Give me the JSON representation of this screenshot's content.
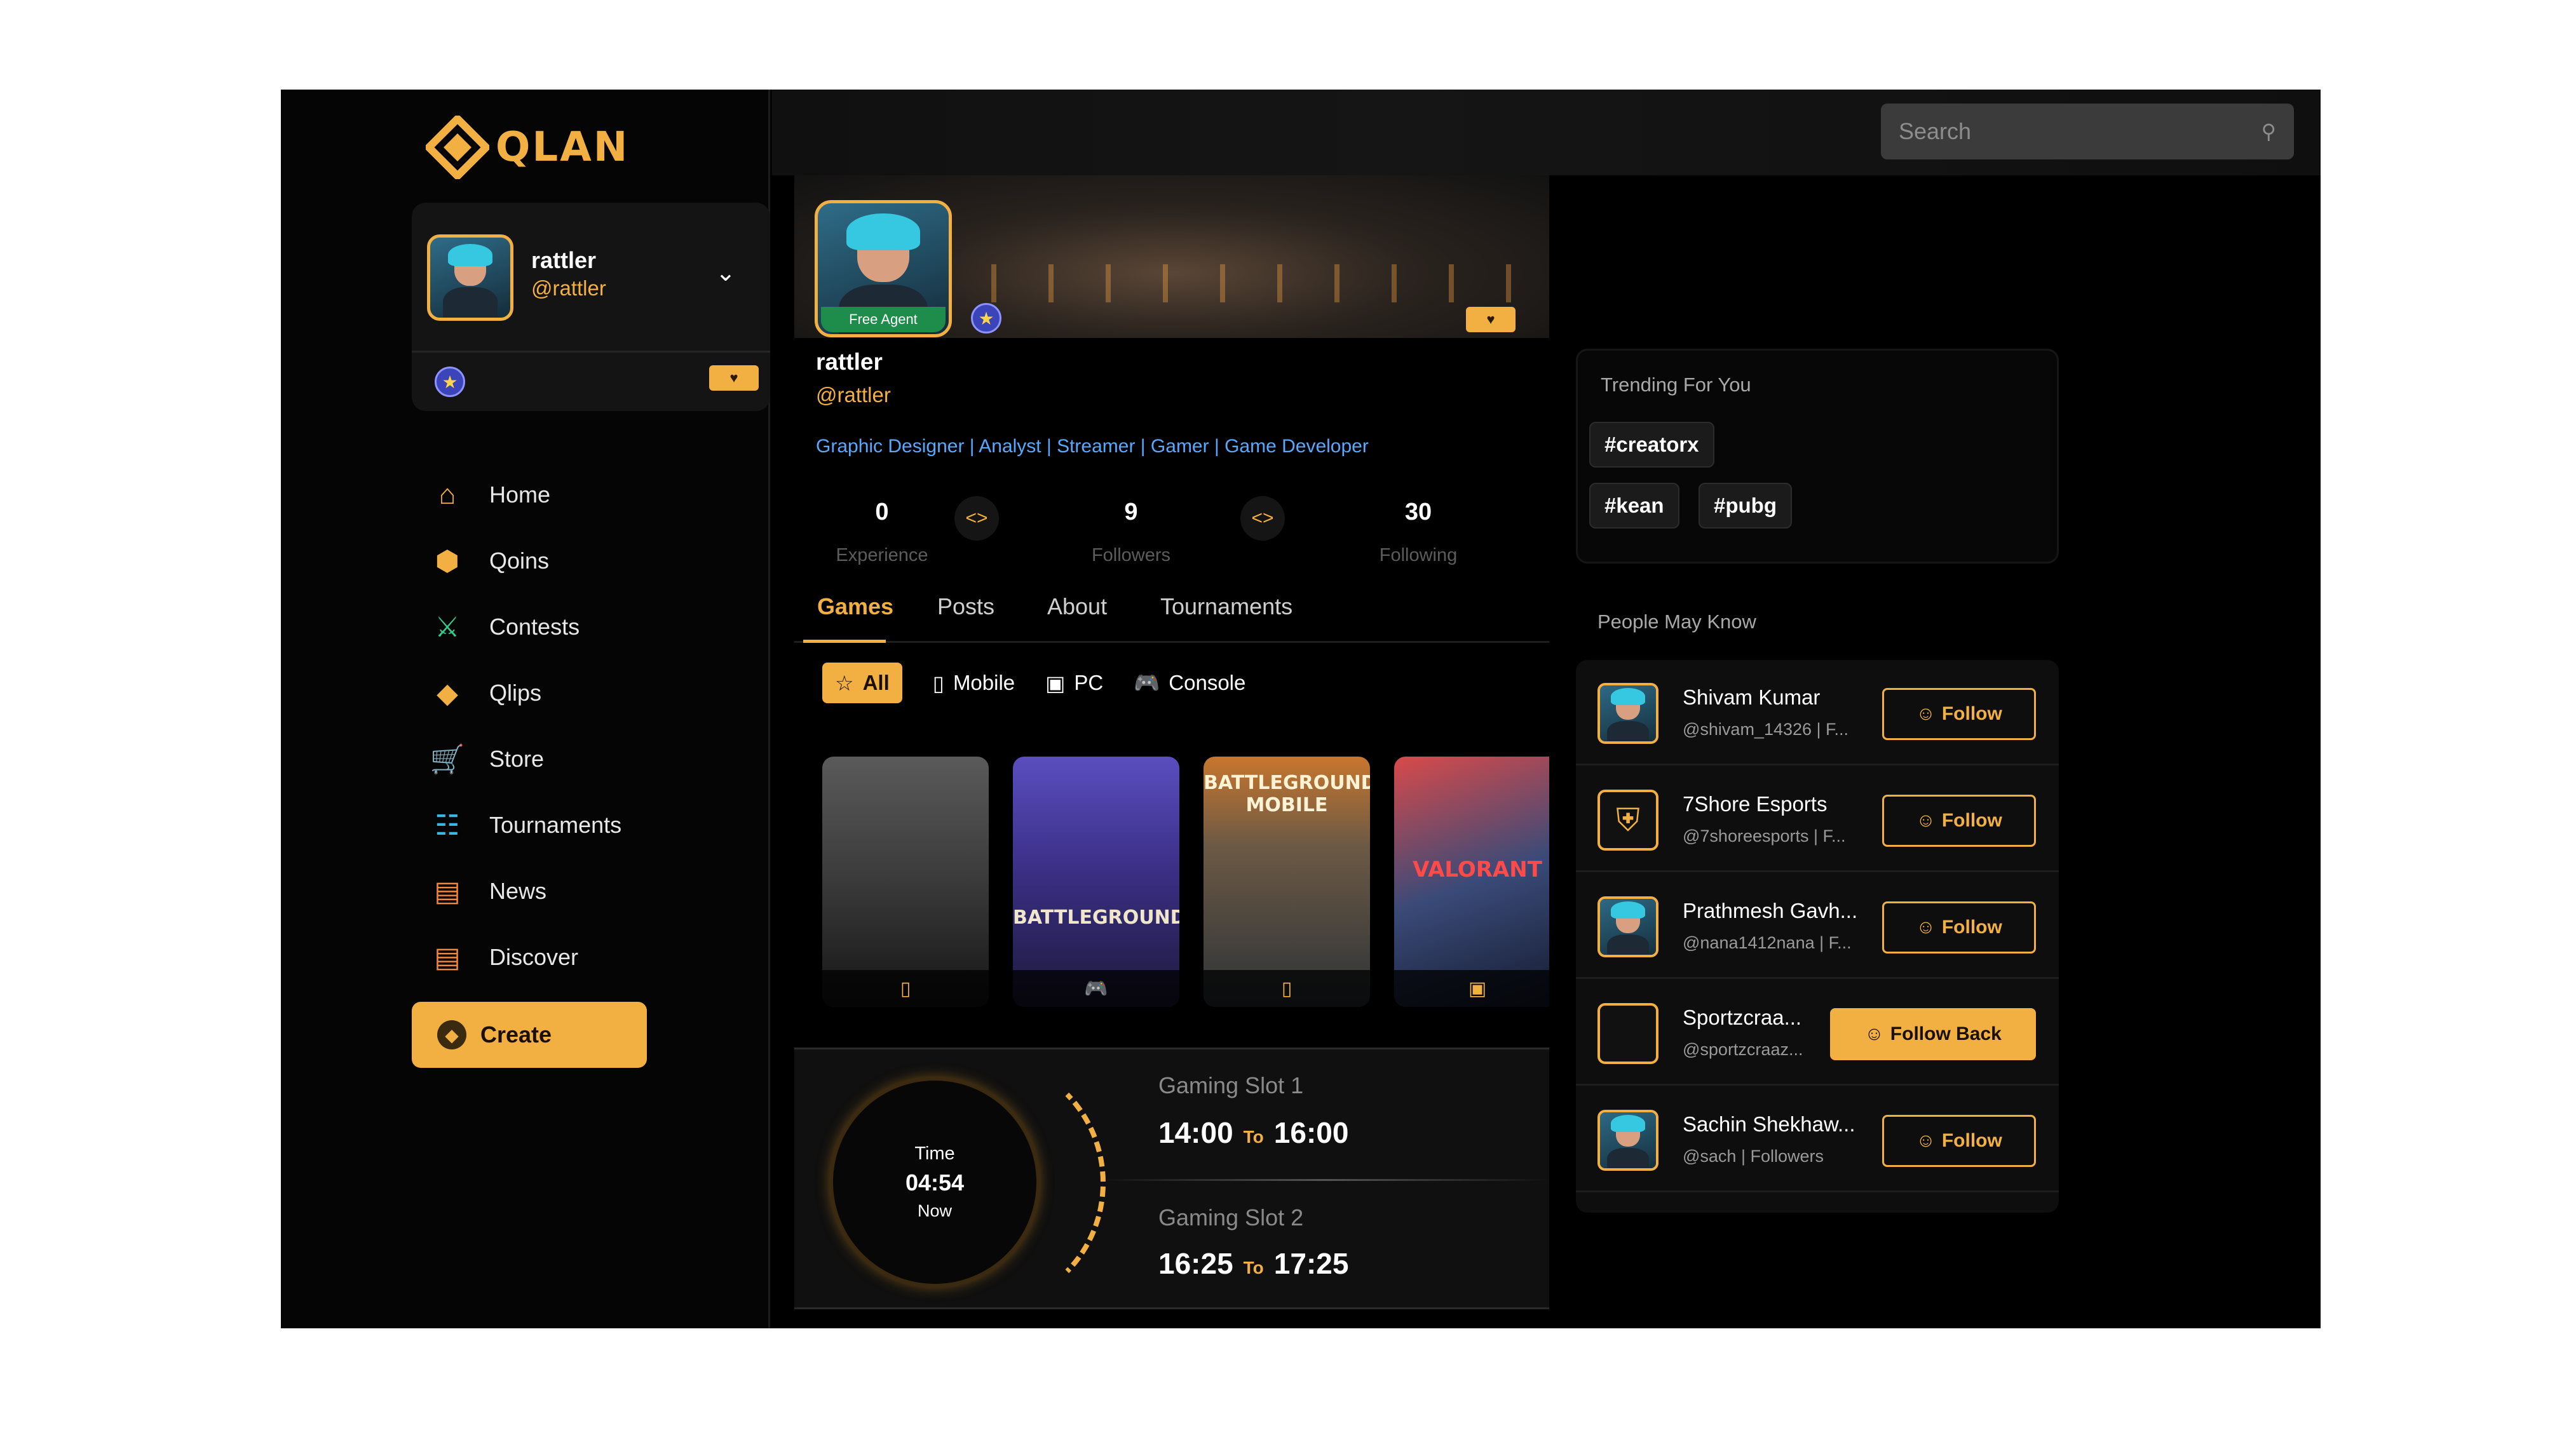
{
  "brand": {
    "logo_text": "QLAN"
  },
  "colors": {
    "accent": "#f2b043",
    "background": "#000000",
    "link": "#57a8ff",
    "free_agent": "#1e8c4a"
  },
  "sidebar": {
    "user": {
      "name": "rattler",
      "handle": "@rattler"
    },
    "nav": [
      {
        "label": "Home",
        "icon": "home-icon"
      },
      {
        "label": "Qoins",
        "icon": "coin-icon"
      },
      {
        "label": "Contests",
        "icon": "sword-icon"
      },
      {
        "label": "Qlips",
        "icon": "play-diamond-icon"
      },
      {
        "label": "Store",
        "icon": "cart-icon"
      },
      {
        "label": "Tournaments",
        "icon": "stadium-icon"
      },
      {
        "label": "News",
        "icon": "news-icon"
      },
      {
        "label": "Discover",
        "icon": "discover-icon"
      }
    ],
    "create_label": "Create"
  },
  "topbar": {
    "search_placeholder": "Search"
  },
  "profile": {
    "badge": "Free Agent",
    "name": "rattler",
    "handle": "@rattler",
    "roles": "Graphic Designer | Analyst | Streamer | Gamer | Game Developer",
    "stats": [
      {
        "value": "0",
        "label": "Experience"
      },
      {
        "value": "9",
        "label": "Followers"
      },
      {
        "value": "30",
        "label": "Following"
      }
    ]
  },
  "tabs": [
    "Games",
    "Posts",
    "About",
    "Tournaments"
  ],
  "filters": [
    "All",
    "Mobile",
    "PC",
    "Console"
  ],
  "games": [
    {
      "title": "",
      "platform": "mobile"
    },
    {
      "title": "BATTLEGROUNDS",
      "platform": "console"
    },
    {
      "title": "BATTLEGROUNDS MOBILE",
      "platform": "mobile"
    },
    {
      "title": "VALORANT",
      "platform": "pc"
    }
  ],
  "schedule": {
    "clock_label": "Time",
    "clock_time": "04:54",
    "clock_sub": "Now",
    "to_label": "To",
    "slots": [
      {
        "label": "Gaming Slot 1",
        "start": "14:00",
        "end": "16:00"
      },
      {
        "label": "Gaming Slot 2",
        "start": "16:25",
        "end": "17:25"
      }
    ]
  },
  "trending": {
    "title": "Trending For You",
    "tags": [
      "#creatorx",
      "#kean",
      "#pubg"
    ]
  },
  "people": {
    "title": "People May Know",
    "list": [
      {
        "name": "Shivam Kumar",
        "sub": "@shivam_14326 | F...",
        "action": "Follow"
      },
      {
        "name": "7Shore Esports",
        "sub": "@7shoreesports | F...",
        "action": "Follow"
      },
      {
        "name": "Prathmesh Gavh...",
        "sub": "@nana1412nana | F...",
        "action": "Follow"
      },
      {
        "name": "Sportzcraa...",
        "sub": "@sportzcraaz...",
        "action": "Follow Back"
      },
      {
        "name": "Sachin Shekhaw...",
        "sub": "@sach | Followers",
        "action": "Follow"
      }
    ]
  }
}
